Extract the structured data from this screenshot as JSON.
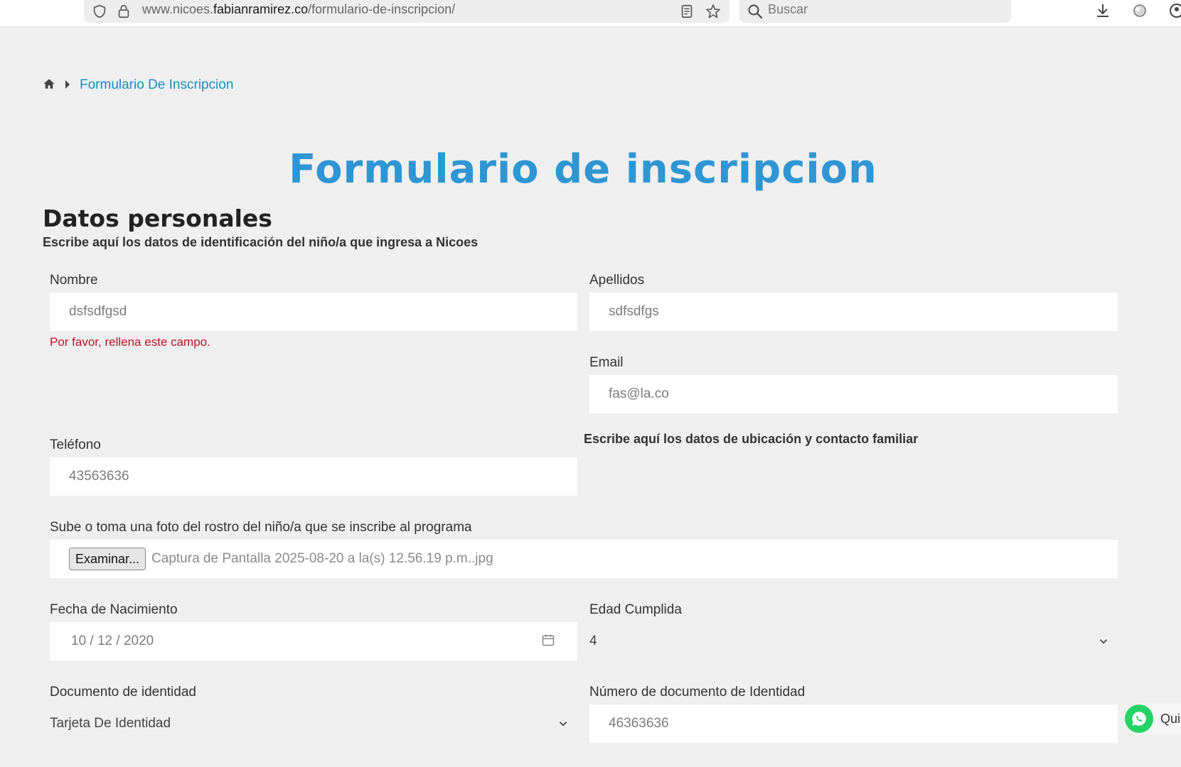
{
  "browser": {
    "url_prefix": "www.nicoes.",
    "url_domain": "fabianramirez.co",
    "url_path": "/formulario-de-inscripcion/",
    "search_placeholder": "Buscar"
  },
  "breadcrumb": {
    "current": "Formulario De Inscripcion"
  },
  "page": {
    "title": "Formulario de inscripcion",
    "section_title": "Datos personales",
    "section_subtitle": "Escribe aquí los datos de identificación del niño/a que ingresa a Nicoes",
    "contact_note": "Escribe aquí los datos de ubicación y contacto familiar"
  },
  "form": {
    "nombre": {
      "label": "Nombre",
      "value": "dsfsdfgsd",
      "error": "Por favor, rellena este campo."
    },
    "apellidos": {
      "label": "Apellidos",
      "value": "sdfsdfgs"
    },
    "email": {
      "label": "Email",
      "value": "fas@la.co"
    },
    "telefono": {
      "label": "Teléfono",
      "value": "43563636"
    },
    "foto": {
      "label": "Sube o toma una foto del rostro del niño/a que se inscribe al programa",
      "button": "Examinar...",
      "file_name": "Captura de Pantalla 2025-08-20 a la(s) 12.56.19 p.m..jpg"
    },
    "fecha_nacimiento": {
      "label": "Fecha de Nacimiento",
      "value": "10 / 12 / 2020"
    },
    "edad": {
      "label": "Edad Cumplida",
      "value": "4"
    },
    "documento": {
      "label": "Documento de identidad",
      "value": "Tarjeta De Identidad"
    },
    "numero_documento": {
      "label": "Número de documento de Identidad",
      "value": "46363636"
    }
  },
  "whatsapp": {
    "label": "Qui"
  },
  "colors": {
    "accent": "#2f95d3",
    "link": "#1a8fbf",
    "error": "#c0102a",
    "whatsapp": "#25d366"
  },
  "icons": [
    "shield-icon",
    "lock-icon",
    "reader-icon",
    "star-icon",
    "search-icon",
    "download-icon",
    "extension-icon",
    "account-icon",
    "home-icon",
    "caret-right-icon",
    "calendar-icon",
    "chevron-down-icon",
    "whatsapp-icon"
  ]
}
